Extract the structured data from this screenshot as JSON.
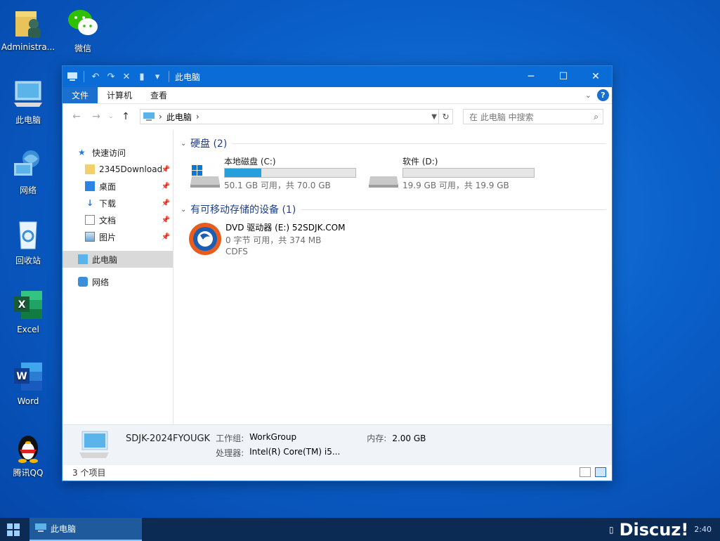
{
  "desktop": {
    "icons": [
      {
        "label": "Administra..."
      },
      {
        "label": "微信"
      },
      {
        "label": "此电脑"
      },
      {
        "label": "网络"
      },
      {
        "label": "回收站"
      },
      {
        "label": "Excel"
      },
      {
        "label": "Word"
      },
      {
        "label": "腾讯QQ"
      }
    ]
  },
  "window": {
    "title": "此电脑",
    "controls": {
      "minimize": "─",
      "maximize": "☐",
      "close": "✕"
    },
    "ribbon": {
      "file": "文件",
      "computer": "计算机",
      "view": "查看",
      "help": "?"
    },
    "address": {
      "crumb": "此电脑",
      "sep": "›"
    },
    "search": {
      "placeholder": "在 此电脑 中搜索"
    }
  },
  "nav": {
    "quick_access": "快速访问",
    "items": [
      {
        "label": "2345Download"
      },
      {
        "label": "桌面"
      },
      {
        "label": "下载"
      },
      {
        "label": "文档"
      },
      {
        "label": "图片"
      }
    ],
    "this_pc": "此电脑",
    "network": "网络"
  },
  "groups": {
    "hard_disks": "硬盘 (2)",
    "removable": "有可移动存储的设备 (1)"
  },
  "drives": [
    {
      "name": "本地磁盘 (C:)",
      "usage": "50.1 GB 可用，共 70.0 GB",
      "used_fraction": 0.28
    },
    {
      "name": "软件 (D:)",
      "usage": "19.9 GB 可用，共 19.9 GB",
      "used_fraction": 0.0
    }
  ],
  "dvd": {
    "name": "DVD 驱动器 (E:) 52SDJK.COM",
    "usage": "0 字节 可用，共 374 MB",
    "fs": "CDFS"
  },
  "details": {
    "pc_name": "SDJK-2024FYOUGK",
    "workgroup_key": "工作组:",
    "workgroup_val": "WorkGroup",
    "memory_key": "内存:",
    "memory_val": "2.00 GB",
    "cpu_key": "处理器:",
    "cpu_val": "Intel(R) Core(TM) i5..."
  },
  "status": {
    "items": "3 个项目"
  },
  "taskbar": {
    "app_label": "此电脑",
    "brand": "Discuz!",
    "clock": "2:40"
  },
  "colors": {
    "accent": "#0a6cd6",
    "drive_fill": "#26a0da",
    "taskbar": "#0b2b55"
  }
}
